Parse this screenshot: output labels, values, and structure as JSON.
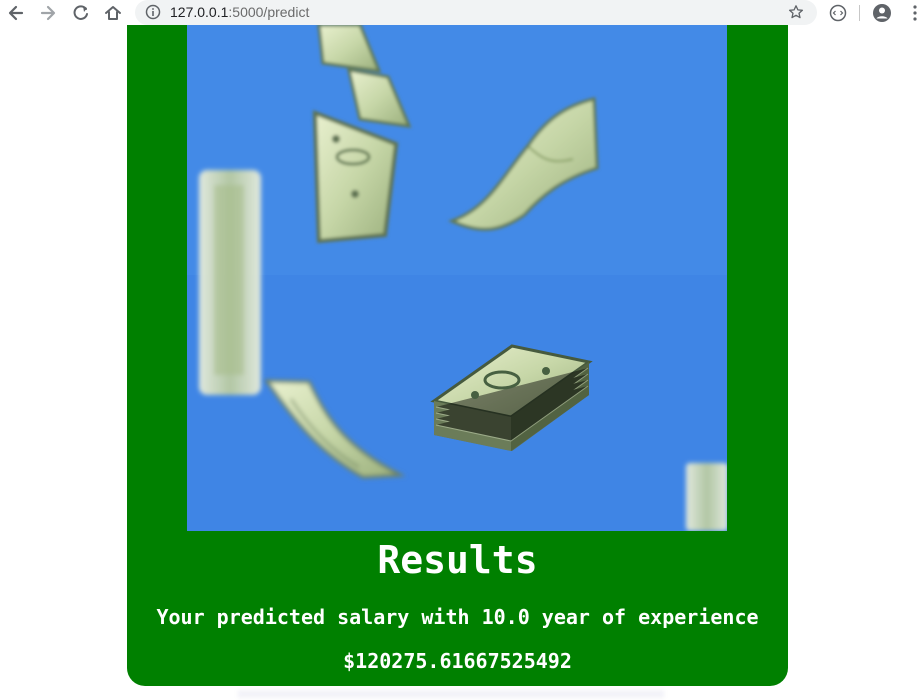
{
  "browser": {
    "url_host": "127.0.0.1",
    "url_path": ":5000/predict"
  },
  "page": {
    "results_heading": "Results",
    "prediction_label": "Your predicted salary with 10.0 year of experience",
    "salary_value": "$120275.61667525492"
  },
  "colors": {
    "card_background": "#008000",
    "text_color": "#ffffff",
    "image_sky": "#3f86e5"
  },
  "icons": {
    "back": "back-arrow-icon",
    "forward": "forward-arrow-icon",
    "reload": "reload-icon",
    "home": "home-icon",
    "site_info": "info-icon",
    "bookmark": "star-icon",
    "extension": "extension-icon",
    "profile": "account-icon",
    "menu": "menu-dots-icon",
    "image": "falling-money-image"
  }
}
